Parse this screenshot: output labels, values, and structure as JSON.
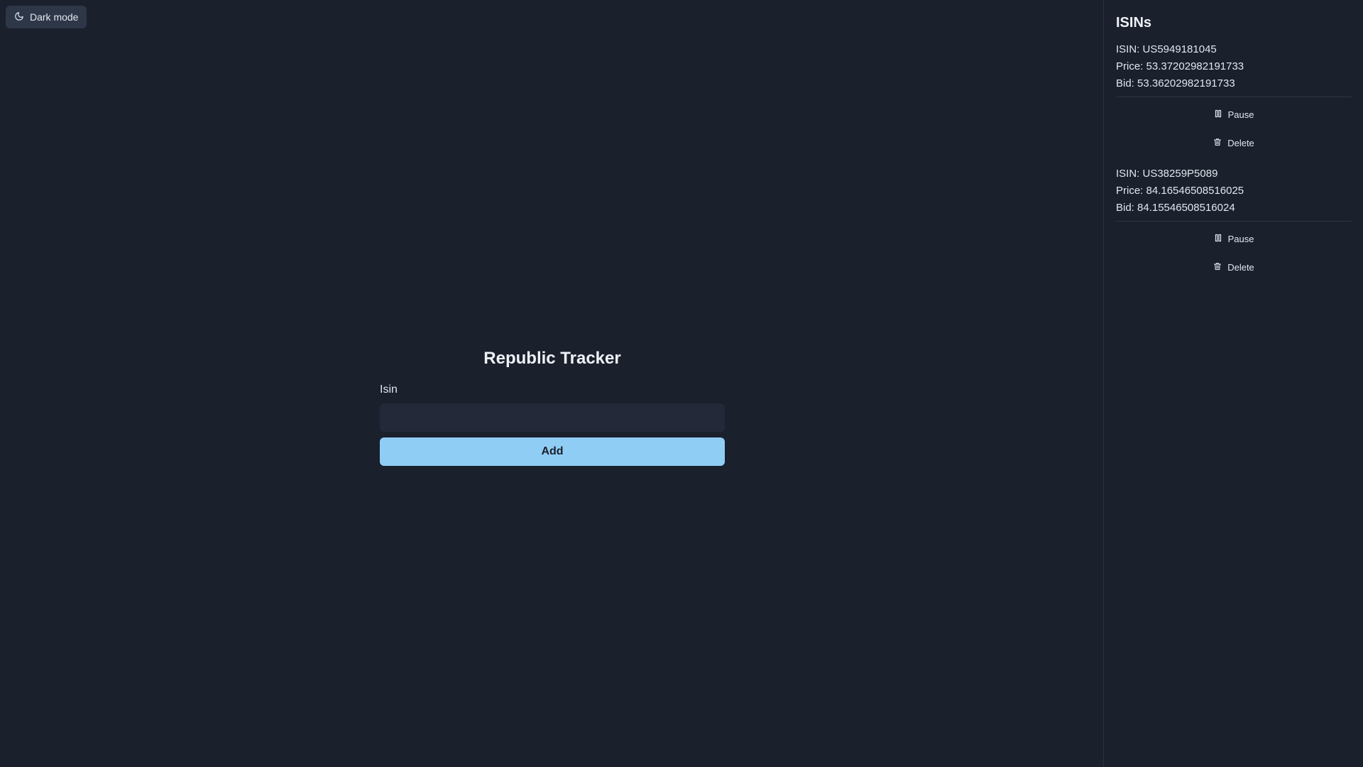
{
  "toggle": {
    "label": "Dark mode",
    "icon": "moon-icon"
  },
  "main": {
    "title": "Republic Tracker",
    "isin_label": "Isin",
    "isin_value": "",
    "isin_placeholder": "",
    "add_label": "Add"
  },
  "sidebar": {
    "title": "ISINs",
    "items": [
      {
        "isin": "ISIN: US5949181045",
        "price": "Price: 53.37202982191733",
        "bid": "Bid: 53.36202982191733",
        "pause_label": "Pause",
        "delete_label": "Delete"
      },
      {
        "isin": "ISIN: US38259P5089",
        "price": "Price: 84.16546508516025",
        "bid": "Bid: 84.15546508516024",
        "pause_label": "Pause",
        "delete_label": "Delete"
      }
    ]
  },
  "colors": {
    "background": "#1a202c",
    "accent": "#90cdf4",
    "panel": "#2d3748"
  }
}
